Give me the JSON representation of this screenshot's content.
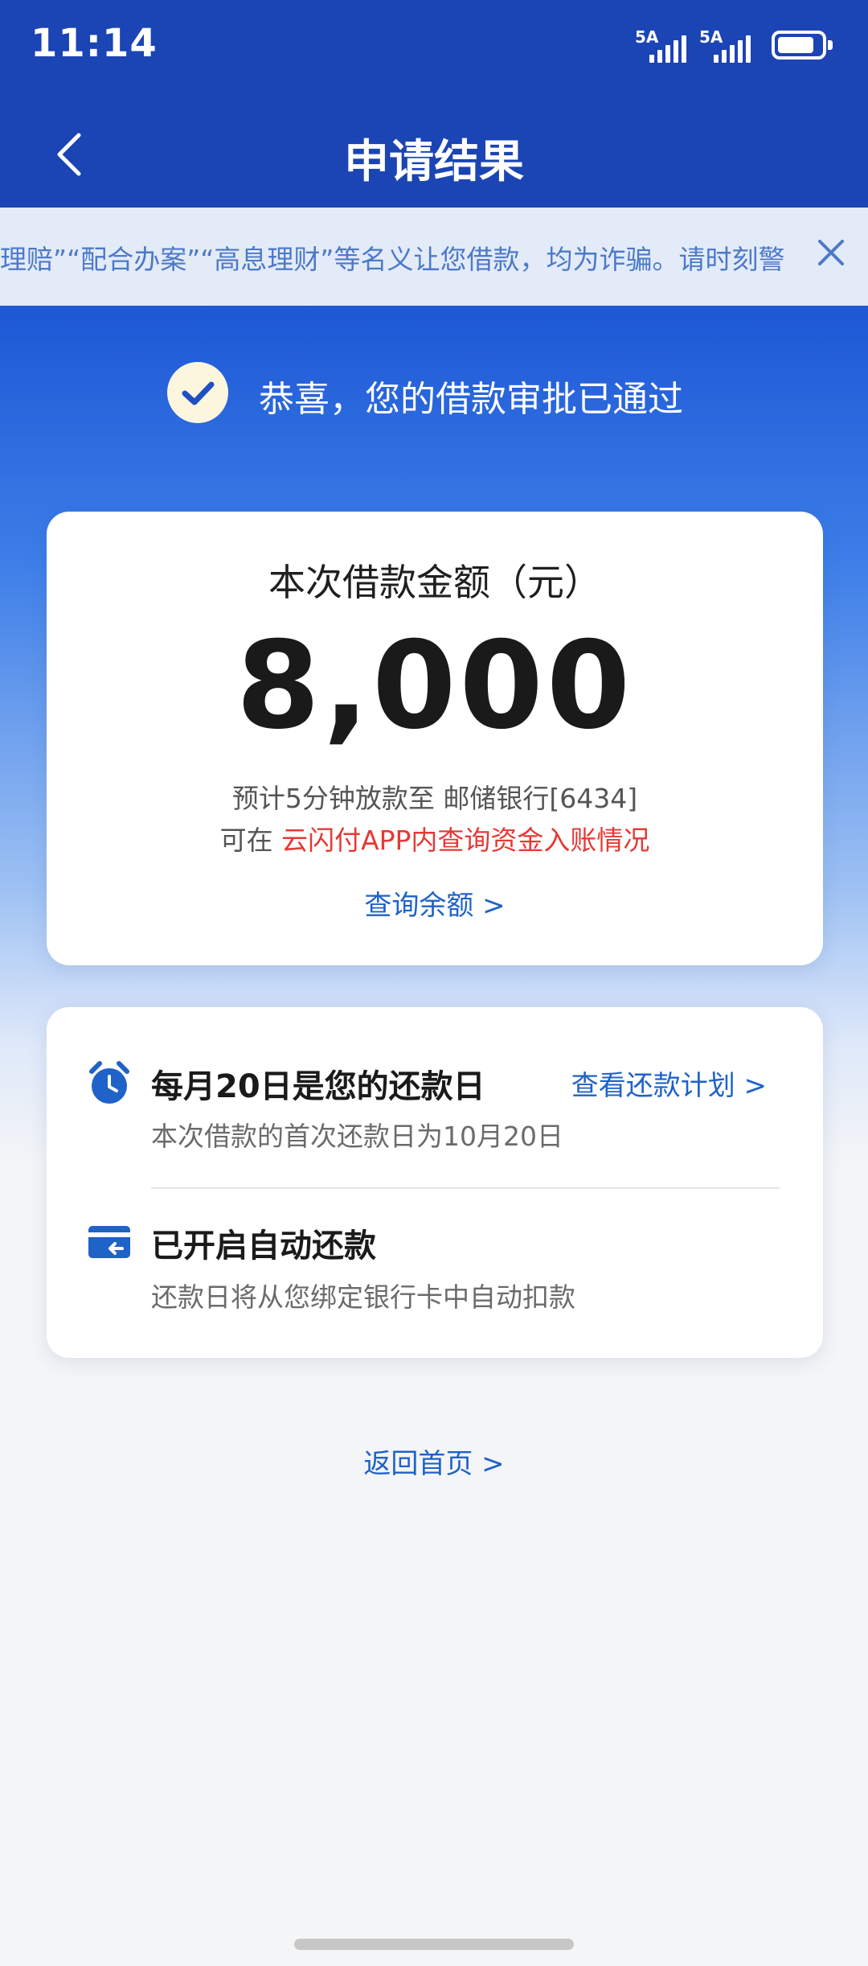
{
  "status_bar": {
    "time": "11:14",
    "signal1_label": "5A",
    "signal2_label": "5A"
  },
  "nav": {
    "title": "申请结果"
  },
  "notice": {
    "text": "理赔”“配合办案”“高息理财”等名义让您借款，均为诈骗。请时刻警"
  },
  "success": {
    "text": "恭喜，您的借款审批已通过"
  },
  "amount_card": {
    "label": "本次借款金额（元）",
    "value": "8,000",
    "line1": "预计5分钟放款至 邮储银行[6434]",
    "line2_prefix": "可在 ",
    "line2_highlight": "云闪付APP内查询资金入账情况",
    "query_link": "查询余额 >"
  },
  "repay_card": {
    "title1": "每月20日是您的还款日",
    "link": "查看还款计划  >",
    "sub1": "本次借款的首次还款日为10月20日",
    "title2": "已开启自动还款",
    "sub2": "还款日将从您绑定银行卡中自动扣款"
  },
  "home_link": "返回首页 >",
  "colors": {
    "brand_blue": "#1b44b4",
    "link_blue": "#1f62c8",
    "warning_red": "#e53935"
  },
  "icons": {
    "back": "chevron-left-icon",
    "close": "close-icon",
    "check": "check-circle-icon",
    "alarm": "alarm-clock-icon",
    "card": "bank-card-refund-icon"
  }
}
